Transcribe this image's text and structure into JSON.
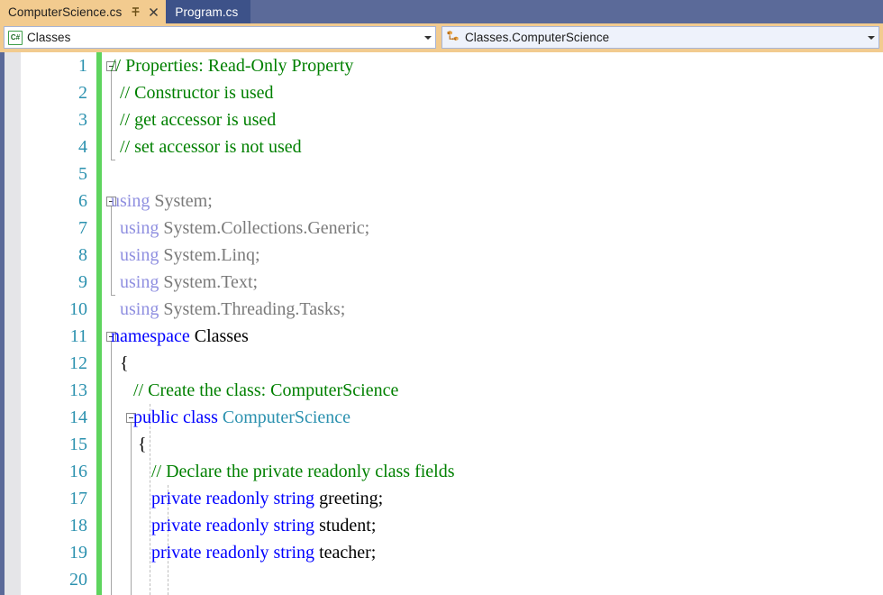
{
  "tabs": [
    {
      "label": "ComputerScience.cs",
      "active": true,
      "pin_icon": "pin-icon",
      "close_icon": "close-icon"
    },
    {
      "label": "Program.cs",
      "active": false
    }
  ],
  "navbar": {
    "project_combo": {
      "icon": "csharp-file-icon",
      "icon_text": "C#",
      "value": "Classes",
      "arrow_icon": "chevron-down-icon"
    },
    "member_combo": {
      "icon": "class-icon",
      "value": "Classes.ComputerScience",
      "arrow_icon": "chevron-down-icon"
    }
  },
  "editor": {
    "accent_green": "#5ed45e",
    "line_number_color": "#2b91af",
    "comment_color": "#008000",
    "keyword_color": "#0000ff",
    "using_color": "#8f8fe0",
    "type_color": "#2b91af",
    "lines": [
      {
        "n": "1",
        "segs": [
          {
            "t": "// Properties: Read-Only Property",
            "c": "c-comment"
          }
        ]
      },
      {
        "n": "2",
        "segs": [
          {
            "t": "  // Constructor is used",
            "c": "c-comment"
          }
        ]
      },
      {
        "n": "3",
        "segs": [
          {
            "t": "  // get accessor is used",
            "c": "c-comment"
          }
        ]
      },
      {
        "n": "4",
        "segs": [
          {
            "t": "  // set accessor is not used",
            "c": "c-comment"
          }
        ]
      },
      {
        "n": "5",
        "segs": []
      },
      {
        "n": "6",
        "segs": [
          {
            "t": "using ",
            "c": "c-using"
          },
          {
            "t": "System;",
            "c": "c-ns"
          }
        ]
      },
      {
        "n": "7",
        "segs": [
          {
            "t": "  using ",
            "c": "c-using"
          },
          {
            "t": "System.Collections.Generic;",
            "c": "c-ns"
          }
        ]
      },
      {
        "n": "8",
        "segs": [
          {
            "t": "  using ",
            "c": "c-using"
          },
          {
            "t": "System.Linq;",
            "c": "c-ns"
          }
        ]
      },
      {
        "n": "9",
        "segs": [
          {
            "t": "  using ",
            "c": "c-using"
          },
          {
            "t": "System.Text;",
            "c": "c-ns"
          }
        ]
      },
      {
        "n": "10",
        "segs": [
          {
            "t": "  using ",
            "c": "c-using"
          },
          {
            "t": "System.Threading.Tasks;",
            "c": "c-ns"
          }
        ]
      },
      {
        "n": "11",
        "segs": [
          {
            "t": "namespace ",
            "c": "c-keyword"
          },
          {
            "t": "Classes",
            "c": "c-plain"
          }
        ]
      },
      {
        "n": "12",
        "segs": [
          {
            "t": "  {",
            "c": "c-plain"
          }
        ]
      },
      {
        "n": "13",
        "segs": [
          {
            "t": "     // Create the class: ComputerScience",
            "c": "c-comment"
          }
        ]
      },
      {
        "n": "14",
        "segs": [
          {
            "t": "     public class ",
            "c": "c-keyword"
          },
          {
            "t": "ComputerScience",
            "c": "c-type"
          }
        ]
      },
      {
        "n": "15",
        "segs": [
          {
            "t": "      {",
            "c": "c-plain"
          }
        ]
      },
      {
        "n": "16",
        "segs": [
          {
            "t": "         // Declare the private readonly class fields",
            "c": "c-comment"
          }
        ]
      },
      {
        "n": "17",
        "segs": [
          {
            "t": "         private readonly string ",
            "c": "c-keyword"
          },
          {
            "t": "greeting;",
            "c": "c-plain"
          }
        ]
      },
      {
        "n": "18",
        "segs": [
          {
            "t": "         private readonly string ",
            "c": "c-keyword"
          },
          {
            "t": "student;",
            "c": "c-plain"
          }
        ]
      },
      {
        "n": "19",
        "segs": [
          {
            "t": "         private readonly string ",
            "c": "c-keyword"
          },
          {
            "t": "teacher;",
            "c": "c-plain"
          }
        ]
      },
      {
        "n": "20",
        "segs": []
      }
    ],
    "fold_markers": [
      {
        "name": "fold-comment-block",
        "line": 1
      },
      {
        "name": "fold-using-block",
        "line": 6
      },
      {
        "name": "fold-namespace",
        "line": 11
      },
      {
        "name": "fold-class",
        "line": 14
      }
    ]
  }
}
